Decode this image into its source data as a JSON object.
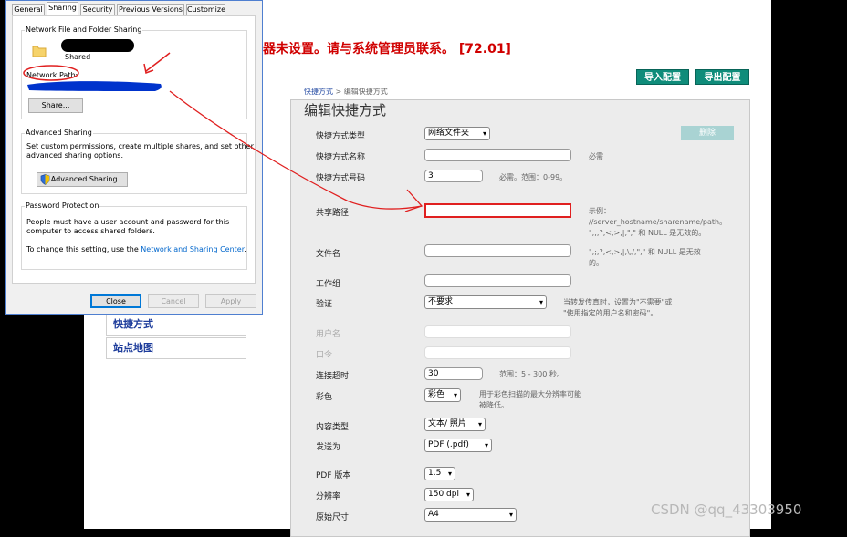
{
  "web": {
    "error_text": "器未设置。请与系统管理员联系。 [72.01]",
    "import_button": "导入配置",
    "export_button": "导出配置",
    "breadcrumb_link": "快捷方式",
    "breadcrumb_rest": " > 编辑快捷方式",
    "panel_title": "编辑快捷方式",
    "delete_button": "删除",
    "left_nav": [
      "快捷方式",
      "站点地图"
    ],
    "form": {
      "type_label": "快捷方式类型",
      "type_value": "网络文件夹",
      "name_label": "快捷方式名称",
      "name_hint": "必需",
      "number_label": "快捷方式号码",
      "number_value": "3",
      "number_hint": "必需。范围：0-99。",
      "share_label": "共享路径",
      "share_hint_1": "示例：",
      "share_hint_2": "//server_hostname/sharename/path。",
      "share_hint_3": "\",;,?,<,>,|,\",\" 和 NULL 是无效的。",
      "file_label": "文件名",
      "file_hint_1": "\",;,?,<,>,|,\\,/,\",\" 和 NULL 是无效",
      "file_hint_2": "的。",
      "workgroup_label": "工作组",
      "auth_label": "验证",
      "auth_value": "不要求",
      "auth_hint_1": "当转发传真时，设置为\"不需要\"或",
      "auth_hint_2": "\"使用指定的用户名和密码\"。",
      "user_label": "用户名",
      "pass_label": "口令",
      "timeout_label": "连接超时",
      "timeout_value": "30",
      "timeout_hint": "范围：5 - 300 秒。",
      "color_label": "彩色",
      "color_value": "彩色",
      "color_hint_1": "用于彩色扫描的最大分辨率可能",
      "color_hint_2": "被降低。",
      "content_label": "内容类型",
      "content_value": "文本/ 照片",
      "sendas_label": "发送为",
      "sendas_value": "PDF (.pdf)",
      "pdfver_label": "PDF 版本",
      "pdfver_value": "1.5",
      "res_label": "分辨率",
      "res_value": "150 dpi",
      "size_label": "原始尺寸",
      "size_value": "A4"
    }
  },
  "dialog": {
    "tabs": [
      "General",
      "Sharing",
      "Security",
      "Previous Versions",
      "Customize"
    ],
    "active_tab": "Sharing",
    "nffs_title": "Network File and Folder Sharing",
    "folder_name": "Shared",
    "network_path_label": "Network Path:",
    "share_button": "Share...",
    "adv_title": "Advanced Sharing",
    "adv_desc_1": "Set custom permissions, create multiple shares, and set other",
    "adv_desc_2": "advanced sharing options.",
    "adv_button": "Advanced Sharing...",
    "pw_title": "Password Protection",
    "pw_desc_1": "People must have a user account and password for this",
    "pw_desc_2": "computer to access shared folders.",
    "pw_change_prefix": "To change this setting, use the ",
    "pw_link": "Network and Sharing Center",
    "pw_suffix": ".",
    "close_button": "Close",
    "cancel_button": "Cancel",
    "apply_button": "Apply"
  },
  "watermark": "CSDN @qq_43303950",
  "colors": {
    "teal_button": "#0f8c7a",
    "error_red": "#d00000",
    "highlight_red": "#e02020",
    "scribble_blue": "#0033cc",
    "link_blue": "#0066cc"
  }
}
